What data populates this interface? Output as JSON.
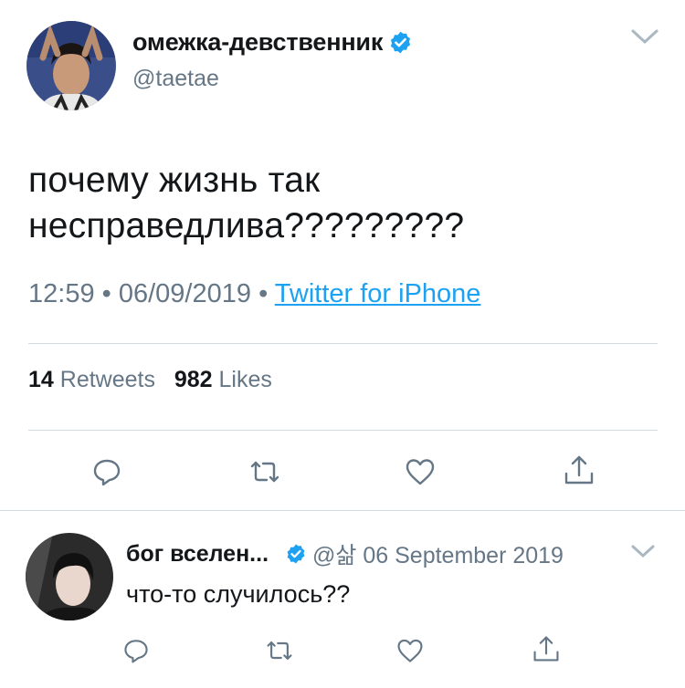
{
  "tweet": {
    "display_name": "омежка-девственник",
    "handle": "@taetae",
    "text_line1": "почему жизнь так",
    "text_line2": "несправедлива?????????",
    "time": "12:59",
    "date": "06/09/2019",
    "source": "Twitter for iPhone",
    "retweets_count": "14",
    "retweets_label": "Retweets",
    "likes_count": "982",
    "likes_label": "Likes"
  },
  "reply": {
    "display_name": "бог вселен...",
    "handle_date": "@삶 06 September 2019",
    "text": "что-то случилось??"
  },
  "icons": {
    "reply": "reply-icon",
    "retweet": "retweet-icon",
    "like": "heart-icon",
    "share": "share-icon",
    "verified": "verified-badge-icon",
    "caret": "chevron-down-icon"
  },
  "colors": {
    "accent": "#1da1f2",
    "secondary_text": "#657786",
    "icon_gray": "#657786",
    "divider": "#d4d9dd"
  },
  "separator": "•"
}
